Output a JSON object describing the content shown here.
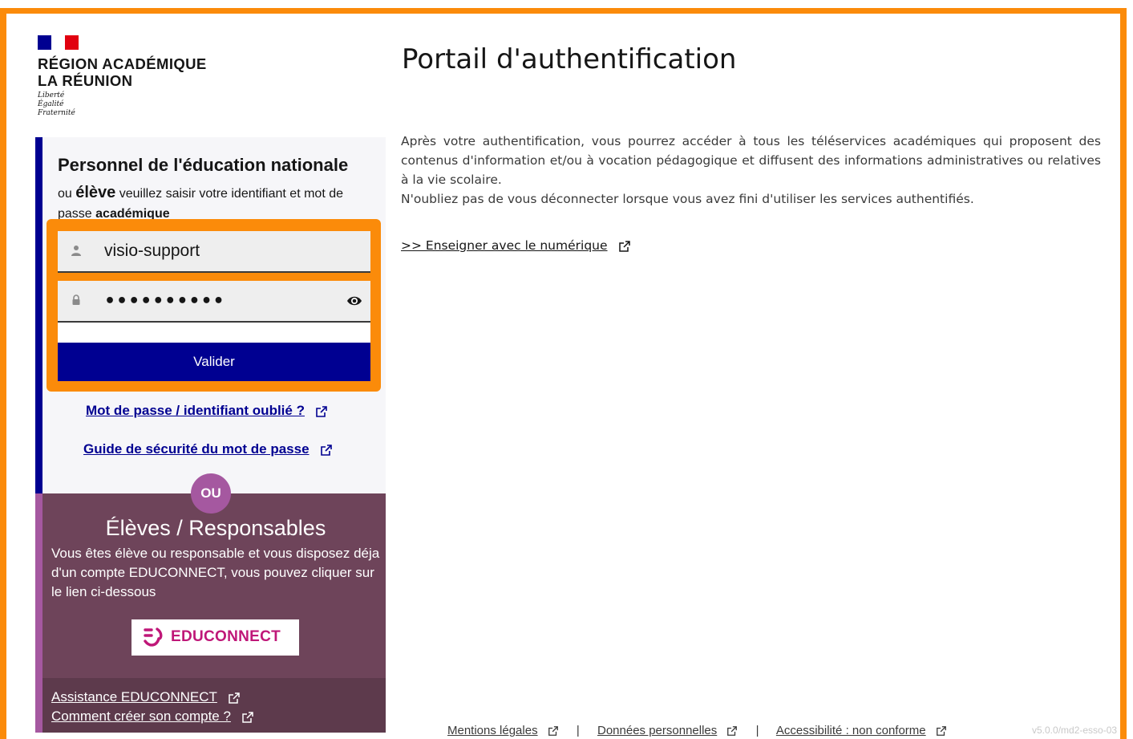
{
  "header": {
    "region_line1": "RÉGION ACADÉMIQUE",
    "region_line2": "LA RÉUNION",
    "motto": [
      "Liberté",
      "Égalité",
      "Fraternité"
    ]
  },
  "login_panel": {
    "title": "Personnel de l'éducation nationale",
    "subtitle_prefix": "ou ",
    "subtitle_eleve": "élève",
    "subtitle_middle": " veuillez saisir votre identifiant et mot de passe ",
    "subtitle_bold_end": "académique",
    "username_value": "visio-support",
    "password_value": "••••••••••",
    "submit_label": "Valider",
    "forgot_link": "Mot de passe / identifiant oublié ?",
    "security_guide_link": "Guide de sécurité du mot de passe"
  },
  "separator": {
    "label": "OU"
  },
  "eleves_panel": {
    "title": "Élèves / Responsables",
    "text": "Vous êtes élève ou responsable et vous disposez déja d'un compte EDUCONNECT, vous pouvez cliquer sur le lien ci-dessous",
    "educonnect_label": "EDUCONNECT",
    "assistance_link": "Assistance EDUCONNECT",
    "create_account_link": "Comment créer son compte ?"
  },
  "main": {
    "title": "Portail d'authentification",
    "intro_paragraph1": "Après votre authentification, vous pourrez accéder à tous les téléservices académiques qui proposent des contenus d'information et/ou à vocation pédagogique et diffusent des informations administratives ou relatives à la vie scolaire.",
    "intro_paragraph2": "N'oubliez pas de vous déconnecter lorsque vous avez fini d'utiliser les services authentifiés.",
    "teach_link": ">> Enseigner avec le numérique"
  },
  "footer": {
    "mentions": "Mentions légales",
    "donnees": "Données personnelles",
    "accessibilite": "Accessibilité : non conforme",
    "separator": "|",
    "version": "v5.0.0/md2-esso-03"
  },
  "colors": {
    "highlight": "#fb8b0a",
    "primary_blue": "#000091",
    "purple": "#6e445a",
    "purple_accent": "#a558a0",
    "educonnect_pink": "#bf1778"
  },
  "icons": {
    "user": "user-icon",
    "lock": "lock-icon",
    "eye": "eye-icon",
    "external": "external-link-icon"
  }
}
